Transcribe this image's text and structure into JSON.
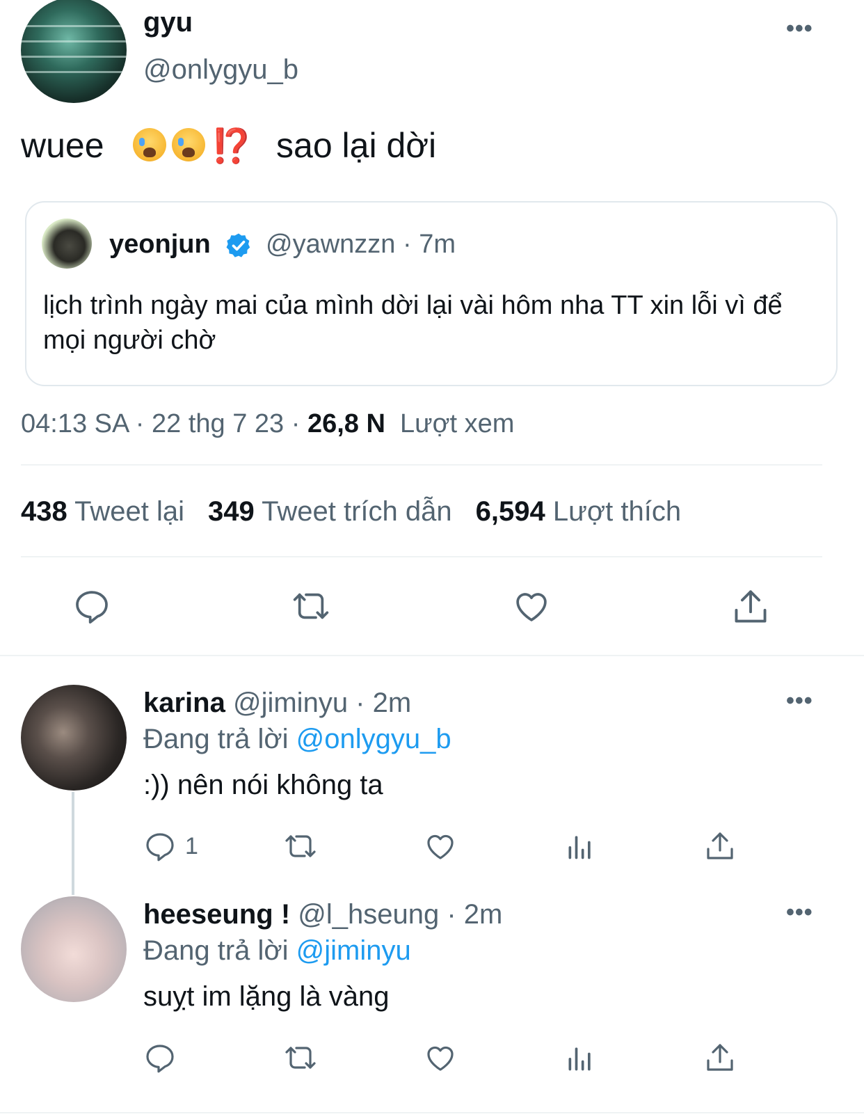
{
  "main_tweet": {
    "author_name": "gyu",
    "author_handle": "@onlygyu_b",
    "more_label": "•••",
    "text_prefix": "wuee",
    "text_emoji": "⁉️",
    "text_suffix": "sao lại dời",
    "quoted": {
      "author_name": "yeonjun",
      "meta": "@yawnzzn · 7m",
      "text": "lịch trình ngày mai của mình dời lại vài hôm nha TT xin lỗi vì để mọi người chờ"
    },
    "time": "04:13 SA · 22 thg 7 23 · ",
    "views_count": "26,8 N",
    "views_label": "Lượt xem",
    "stats": {
      "retweets_count": "438",
      "retweets_label": "Tweet lại",
      "quotes_count": "349",
      "quotes_label": "Tweet trích dẫn",
      "likes_count": "6,594",
      "likes_label": "Lượt thích"
    }
  },
  "replies": [
    {
      "author_name": "karina",
      "meta": "@jiminyu · 2m",
      "replying_label": "Đang trả lời",
      "replying_to": "@onlygyu_b",
      "text": ":)) nên nói không ta",
      "reply_count": "1",
      "more_label": "•••"
    },
    {
      "author_name": "heeseung !",
      "meta": "@l_hseung · 2m",
      "replying_label": "Đang trả lời",
      "replying_to": "@jiminyu",
      "text": "suỵt im lặng là vàng",
      "reply_count": "",
      "more_label": "•••"
    }
  ],
  "icons": {
    "reply": "reply-icon",
    "retweet": "retweet-icon",
    "like": "heart-icon",
    "share": "share-icon",
    "views": "analytics-icon",
    "verified": "verified-badge-icon"
  },
  "colors": {
    "text": "#0f1419",
    "secondary": "#536471",
    "link": "#1d9bf0",
    "divider": "#eff3f4",
    "verified": "#1d9bf0"
  }
}
